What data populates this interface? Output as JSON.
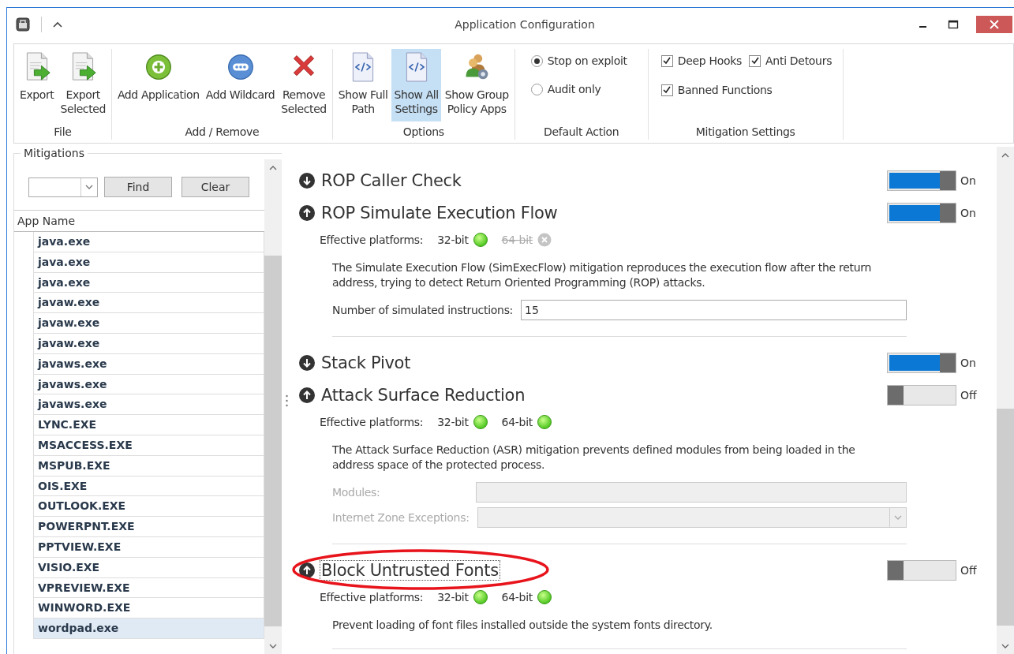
{
  "window": {
    "title": "Application Configuration"
  },
  "ribbon": {
    "groups": [
      {
        "label": "File",
        "buttons": [
          {
            "label": "Export",
            "kind": "export",
            "selected": false
          },
          {
            "label": "Export\nSelected",
            "kind": "export",
            "selected": false
          }
        ]
      },
      {
        "label": "Add / Remove",
        "buttons": [
          {
            "label": "Add Application",
            "kind": "add",
            "selected": false
          },
          {
            "label": "Add Wildcard",
            "kind": "wildcard",
            "selected": false
          },
          {
            "label": "Remove\nSelected",
            "kind": "remove",
            "selected": false
          }
        ]
      },
      {
        "label": "Options",
        "buttons": [
          {
            "label": "Show Full\nPath",
            "kind": "code",
            "selected": false
          },
          {
            "label": "Show All\nSettings",
            "kind": "code",
            "selected": true
          },
          {
            "label": "Show Group\nPolicy Apps",
            "kind": "group",
            "selected": false
          }
        ]
      }
    ],
    "default_action": {
      "label": "Default Action",
      "options": [
        {
          "label": "Stop on exploit",
          "selected": true
        },
        {
          "label": "Audit only",
          "selected": false
        }
      ]
    },
    "mitigation_settings": {
      "label": "Mitigation Settings",
      "options": [
        {
          "label": "Deep Hooks",
          "checked": true
        },
        {
          "label": "Anti Detours",
          "checked": true
        },
        {
          "label": "Banned Functions",
          "checked": true
        }
      ]
    }
  },
  "left_panel": {
    "title": "Mitigations",
    "find_button": "Find",
    "clear_button": "Clear",
    "column": "App Name",
    "rows": [
      {
        "name": "java.exe",
        "selected": false
      },
      {
        "name": "java.exe",
        "selected": false
      },
      {
        "name": "java.exe",
        "selected": false
      },
      {
        "name": "javaw.exe",
        "selected": false
      },
      {
        "name": "javaw.exe",
        "selected": false
      },
      {
        "name": "javaw.exe",
        "selected": false
      },
      {
        "name": "javaws.exe",
        "selected": false
      },
      {
        "name": "javaws.exe",
        "selected": false
      },
      {
        "name": "javaws.exe",
        "selected": false
      },
      {
        "name": "LYNC.EXE",
        "selected": false
      },
      {
        "name": "MSACCESS.EXE",
        "selected": false
      },
      {
        "name": "MSPUB.EXE",
        "selected": false
      },
      {
        "name": "OIS.EXE",
        "selected": false
      },
      {
        "name": "OUTLOOK.EXE",
        "selected": false
      },
      {
        "name": "POWERPNT.EXE",
        "selected": false
      },
      {
        "name": "PPTVIEW.EXE",
        "selected": false
      },
      {
        "name": "VISIO.EXE",
        "selected": false
      },
      {
        "name": "VPREVIEW.EXE",
        "selected": false
      },
      {
        "name": "WINWORD.EXE",
        "selected": false
      },
      {
        "name": "wordpad.exe",
        "selected": true
      }
    ]
  },
  "mitigations": [
    {
      "title": "ROP Caller Check",
      "expanded": false,
      "on": true,
      "state_label": "On"
    },
    {
      "title": "ROP Simulate Execution Flow",
      "expanded": true,
      "on": true,
      "state_label": "On",
      "platforms_label": "Effective platforms:",
      "platforms": [
        {
          "label": "32-bit",
          "supported": true
        },
        {
          "label": "64-bit",
          "supported": false
        }
      ],
      "description": "The Simulate Execution Flow (SimExecFlow) mitigation reproduces the execution flow after the return address, trying to detect Return Oriented Programming (ROP) attacks.",
      "fields": [
        {
          "kind": "text",
          "label": "Number of simulated instructions:",
          "value": "15",
          "disabled": false
        }
      ]
    },
    {
      "title": "Stack Pivot",
      "expanded": false,
      "on": true,
      "state_label": "On"
    },
    {
      "title": "Attack Surface Reduction",
      "expanded": true,
      "on": false,
      "state_label": "Off",
      "platforms_label": "Effective platforms:",
      "platforms": [
        {
          "label": "32-bit",
          "supported": true
        },
        {
          "label": "64-bit",
          "supported": true
        }
      ],
      "description": "The Attack Surface Reduction (ASR) mitigation prevents defined modules from being loaded in the address space of the protected process.",
      "fields": [
        {
          "kind": "text",
          "label": "Modules:",
          "disabled": true
        },
        {
          "kind": "dropdown",
          "label": "Internet Zone Exceptions:",
          "disabled": true
        }
      ]
    },
    {
      "title": "Block Untrusted Fonts",
      "expanded": true,
      "on": false,
      "state_label": "Off",
      "focused": true,
      "platforms_label": "Effective platforms:",
      "platforms": [
        {
          "label": "32-bit",
          "supported": true
        },
        {
          "label": "64-bit",
          "supported": true
        }
      ],
      "description": "Prevent loading of font files installed outside the system fonts directory."
    }
  ]
}
